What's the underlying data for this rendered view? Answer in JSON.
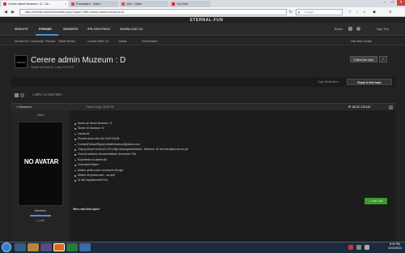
{
  "browser": {
    "tabs": [
      {
        "label": "Cerere admin Muzeum : D - Ce...",
        "active": true
      },
      {
        "label": "Prezentare - Video",
        "active": false
      },
      {
        "label": "Vezi - Video",
        "active": false
      },
      {
        "label": "YouTube",
        "active": false
      }
    ],
    "url": "http://eternal.com/forum/index.php?/topic/7388-cerere-admin-muzeum-d/",
    "search_placeholder": "Google"
  },
  "site": {
    "banner_text": "ETERNAL-FUN",
    "nav": [
      "WEBSITE",
      "FORUMS",
      "MEMBERS",
      "IPB SHOUTBOX",
      "DOWNLOAD CS"
    ],
    "nav_right": [
      "Radio",
      "Sign Out"
    ],
    "breadcrumb": [
      "Eternal-Fun",
      "Community",
      "Forumul"
    ],
    "sub_links": [
      "Online Servers",
      "Counter Strike 1.6",
      "Classic",
      "Cerere Admin"
    ],
    "view_new": "View New Content",
    "topic_title": "Cerere admin Muzeum : D",
    "topic_meta": "Started by Muzeum, Today, 08:40 PM",
    "follow_btn": "Follow this topic",
    "topic_moderation": "Topic Moderation",
    "reply_btn": "Reply to this topic",
    "reply_count": "1 REPLY TO THIS TOPIC",
    "post_author": "Muzeum",
    "post_date": "Posted Today, 08:40 PM",
    "ip": "IP: 88.127.175.104",
    "user_status": "Offline",
    "avatar_text": "NO AVATAR",
    "user_group": "Members",
    "user_posts": "1 posts",
    "post_lines": [
      "Nume pe server:Muzeum :D",
      "Steam ID:Muzeum :D",
      "Varsta:16",
      "Primele doua cifre din CNP:19108",
      "Contact(Yahoo/Skype):danielmuzeum@yahoo.com",
      "Timp jucat pe server(CLICK):http://www.gametracker...Muzeum :D/ imi mai place sa ma joc",
      "Cunosti sistemul de administrare Amxmodx?:Da",
      "Experienta ca admin:Nu",
      "Grad dorit:Helper",
      "Motive pentru care vrei admin:Sa ajut",
      "Motive de promovare:...sa ajut",
      "Ai citit regulamentul?:Da."
    ],
    "like_btn": "Like This",
    "who_read": "Who read this topic?"
  },
  "taskbar": {
    "clock": "8:40 PM",
    "date": "10/14/2013"
  },
  "colors": {
    "accent": "#4a90d9",
    "like": "#3c9a2a",
    "link": "#66aaff"
  }
}
